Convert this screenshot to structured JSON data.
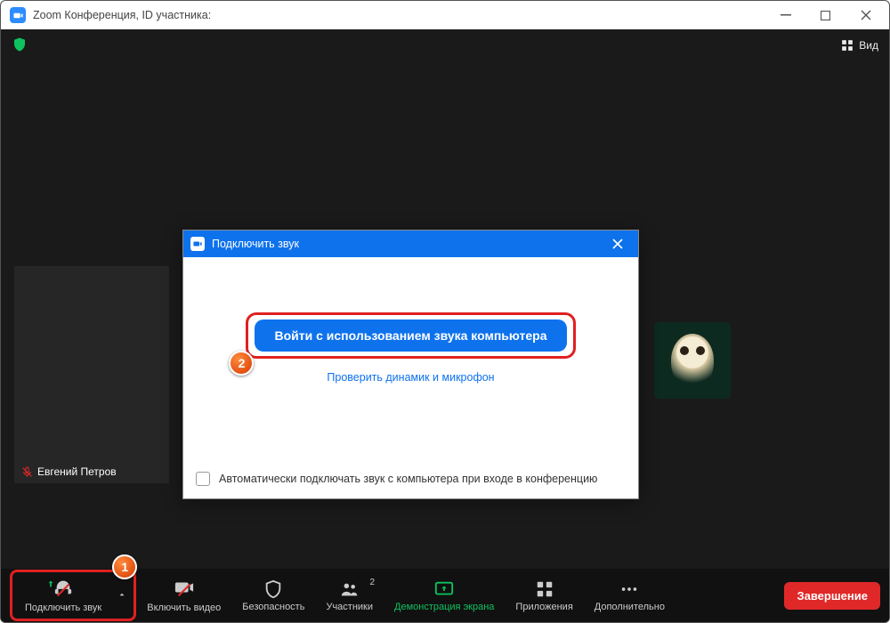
{
  "titlebar": {
    "title": "Zoom Конференция, ID участника:"
  },
  "topstrip": {
    "view_label": "Вид"
  },
  "participant": {
    "name": "Евгений Петров"
  },
  "modal": {
    "title": "Подключить звук",
    "join_button": "Войти с использованием звука компьютера",
    "test_link": "Проверить динамик и микрофон",
    "auto_connect_label": "Автоматически подключать звук с компьютера при входе в конференцию"
  },
  "toolbar": {
    "audio": "Подключить звук",
    "video": "Включить видео",
    "security": "Безопасность",
    "participants": "Участники",
    "participants_count": "2",
    "share": "Демонстрация экрана",
    "apps": "Приложения",
    "more": "Дополнительно",
    "end": "Завершение"
  },
  "markers": {
    "one": "1",
    "two": "2"
  },
  "colors": {
    "accent": "#0e72ed",
    "danger": "#e02828",
    "green": "#0ec25f",
    "highlight": "#e02020"
  }
}
